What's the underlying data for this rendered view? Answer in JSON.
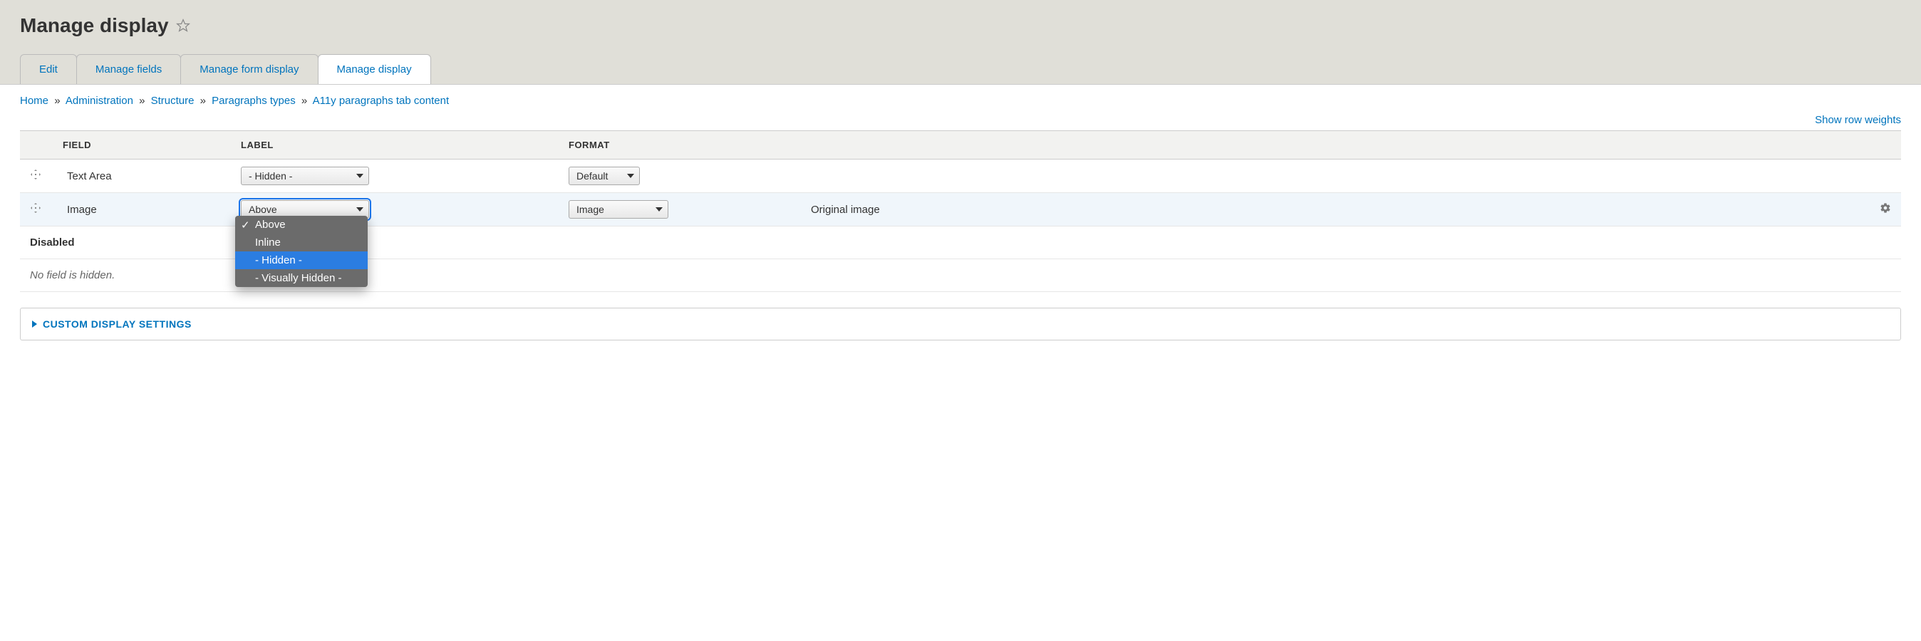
{
  "page": {
    "title": "Manage display"
  },
  "tabs": [
    {
      "label": "Edit"
    },
    {
      "label": "Manage fields"
    },
    {
      "label": "Manage form display"
    },
    {
      "label": "Manage display",
      "active": true
    }
  ],
  "breadcrumb": [
    {
      "label": "Home"
    },
    {
      "label": "Administration"
    },
    {
      "label": "Structure"
    },
    {
      "label": "Paragraphs types"
    },
    {
      "label": "A11y paragraphs tab content"
    }
  ],
  "row_weights_link": "Show row weights",
  "columns": {
    "field": "Field",
    "label": "Label",
    "format": "Format"
  },
  "rows": [
    {
      "field": "Text Area",
      "label_value": "- Hidden -",
      "format_value": "Default"
    },
    {
      "field": "Image",
      "label_value": "Above",
      "format_value": "Image",
      "summary": "Original image",
      "has_settings": true,
      "dropdown_open": true
    }
  ],
  "label_options": [
    {
      "label": "Above",
      "checked": true
    },
    {
      "label": "Inline"
    },
    {
      "label": "- Hidden -",
      "selected": true
    },
    {
      "label": "- Visually Hidden -"
    }
  ],
  "disabled_header": "Disabled",
  "no_hidden_text": "No field is hidden.",
  "details_summary": "Custom display settings"
}
